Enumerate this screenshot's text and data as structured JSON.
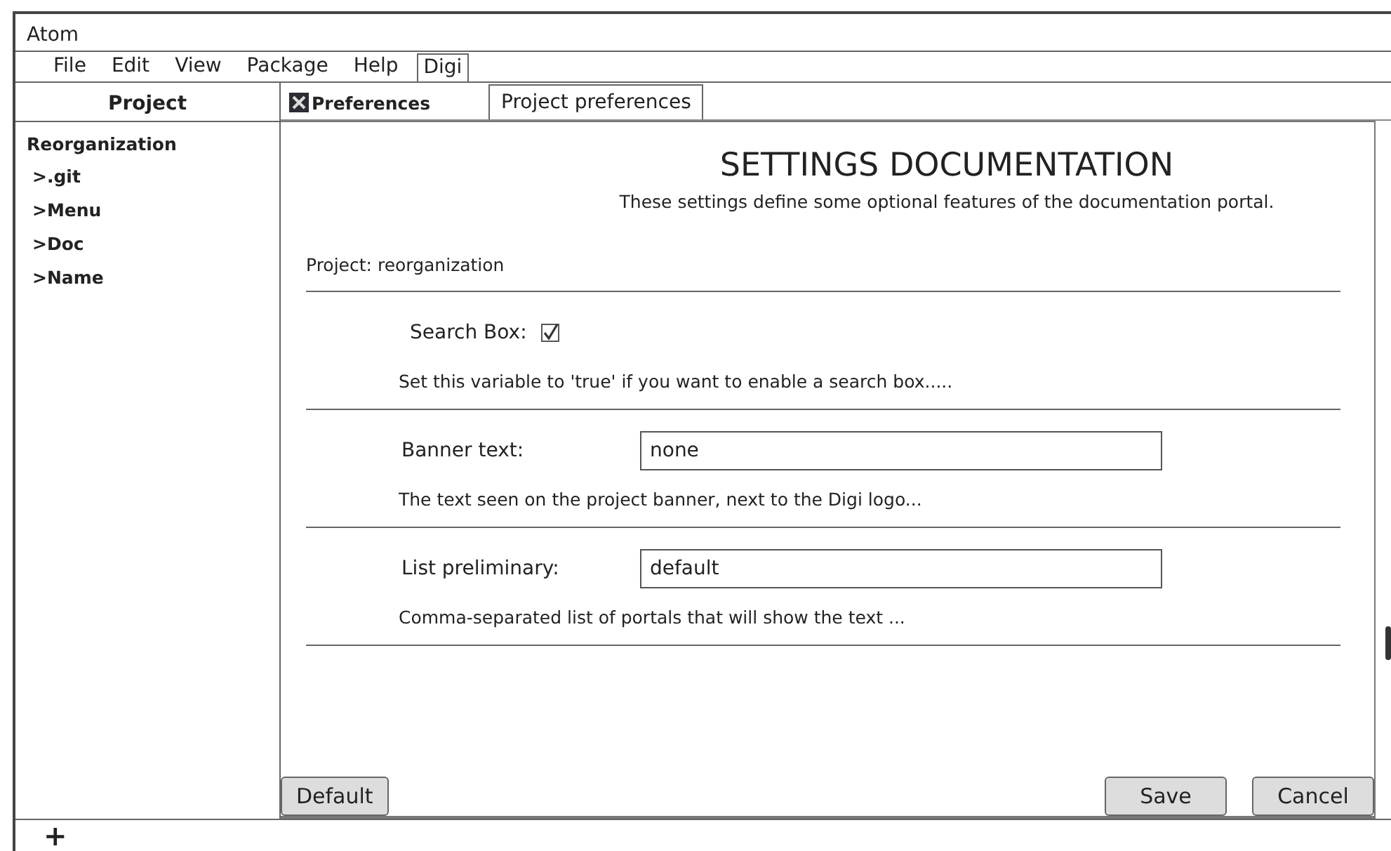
{
  "window": {
    "title": "Atom"
  },
  "menu": [
    {
      "label": "File",
      "selected": false
    },
    {
      "label": "Edit",
      "selected": false
    },
    {
      "label": "View",
      "selected": false
    },
    {
      "label": "Package",
      "selected": false
    },
    {
      "label": "Help",
      "selected": false
    },
    {
      "label": "Digi",
      "selected": true
    }
  ],
  "sidebar": {
    "title": "Project",
    "root": "Reorganization",
    "items": [
      ">.git",
      ">Menu",
      ">Doc",
      ">Name"
    ]
  },
  "tabs": [
    {
      "label": "Preferences",
      "selected": false,
      "kind": "icon"
    },
    {
      "label": "Project preferences",
      "selected": true,
      "kind": "plain"
    }
  ],
  "content": {
    "heading": "SETTINGS DOCUMENTATION",
    "subheading": "These settings define some optional features of the documentation portal.",
    "project": "Project: reorganization",
    "settings": [
      {
        "kind": "checkbox",
        "label": "Search Box:",
        "checked": true,
        "description": "Set this variable to 'true' if you want to enable a search box....."
      },
      {
        "kind": "text",
        "label": "Banner text:",
        "value": "none",
        "description": "The text seen on the project banner, next to the Digi logo..."
      },
      {
        "kind": "text",
        "label": "List preliminary:",
        "value": "default",
        "description": "Comma-separated list of portals that will show the text ..."
      }
    ]
  },
  "buttons": {
    "left": [
      "Default"
    ],
    "right": [
      "Save",
      "Cancel"
    ]
  },
  "status_bar": {
    "add": "+"
  }
}
